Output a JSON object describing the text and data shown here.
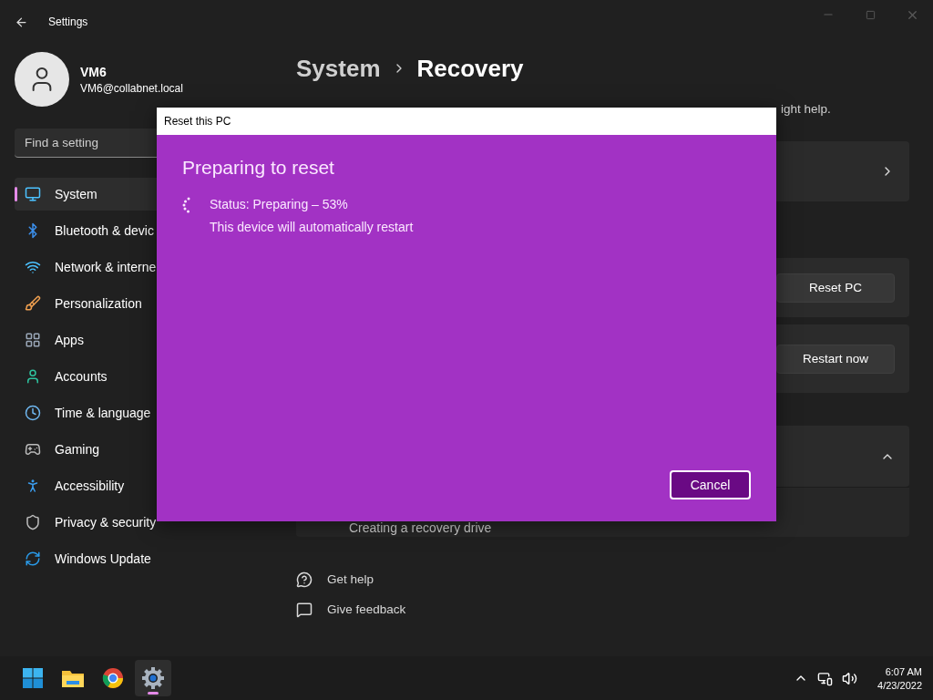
{
  "window": {
    "title": "Settings"
  },
  "account": {
    "name": "VM6",
    "email": "VM6@collabnet.local"
  },
  "search": {
    "placeholder": "Find a setting"
  },
  "nav": [
    {
      "kind": "system",
      "label": "System",
      "selected": true
    },
    {
      "kind": "bluetooth",
      "label": "Bluetooth & devic",
      "selected": false
    },
    {
      "kind": "network",
      "label": "Network & interne",
      "selected": false
    },
    {
      "kind": "personalization",
      "label": "Personalization",
      "selected": false
    },
    {
      "kind": "apps",
      "label": "Apps",
      "selected": false
    },
    {
      "kind": "accounts",
      "label": "Accounts",
      "selected": false
    },
    {
      "kind": "time",
      "label": "Time & language",
      "selected": false
    },
    {
      "kind": "gaming",
      "label": "Gaming",
      "selected": false
    },
    {
      "kind": "accessibility",
      "label": "Accessibility",
      "selected": false
    },
    {
      "kind": "privacy",
      "label": "Privacy & security",
      "selected": false
    },
    {
      "kind": "update",
      "label": "Windows Update",
      "selected": false
    }
  ],
  "breadcrumb": [
    "System",
    "Recovery"
  ],
  "subtitle": "ight help.",
  "cards": [
    {
      "kind": "link"
    },
    {
      "kind": "button",
      "button": "Reset PC"
    },
    {
      "kind": "button",
      "button": "Restart now"
    },
    {
      "kind": "expander",
      "expanded": true,
      "item": "Creating a recovery drive"
    }
  ],
  "links": [
    {
      "kind": "help",
      "label": "Get help"
    },
    {
      "kind": "feedback",
      "label": "Give feedback"
    }
  ],
  "dialog": {
    "title": "Reset this PC",
    "heading": "Preparing to reset",
    "status": "Status: Preparing – 53%",
    "note": "This device will automatically restart",
    "cancel": "Cancel"
  },
  "taskbar": {
    "apps": [
      {
        "kind": "start",
        "selected": false
      },
      {
        "kind": "explorer",
        "selected": false
      },
      {
        "kind": "browser",
        "selected": false
      },
      {
        "kind": "settings",
        "selected": true
      }
    ],
    "time": "6:07 AM",
    "date": "4/23/2022"
  }
}
